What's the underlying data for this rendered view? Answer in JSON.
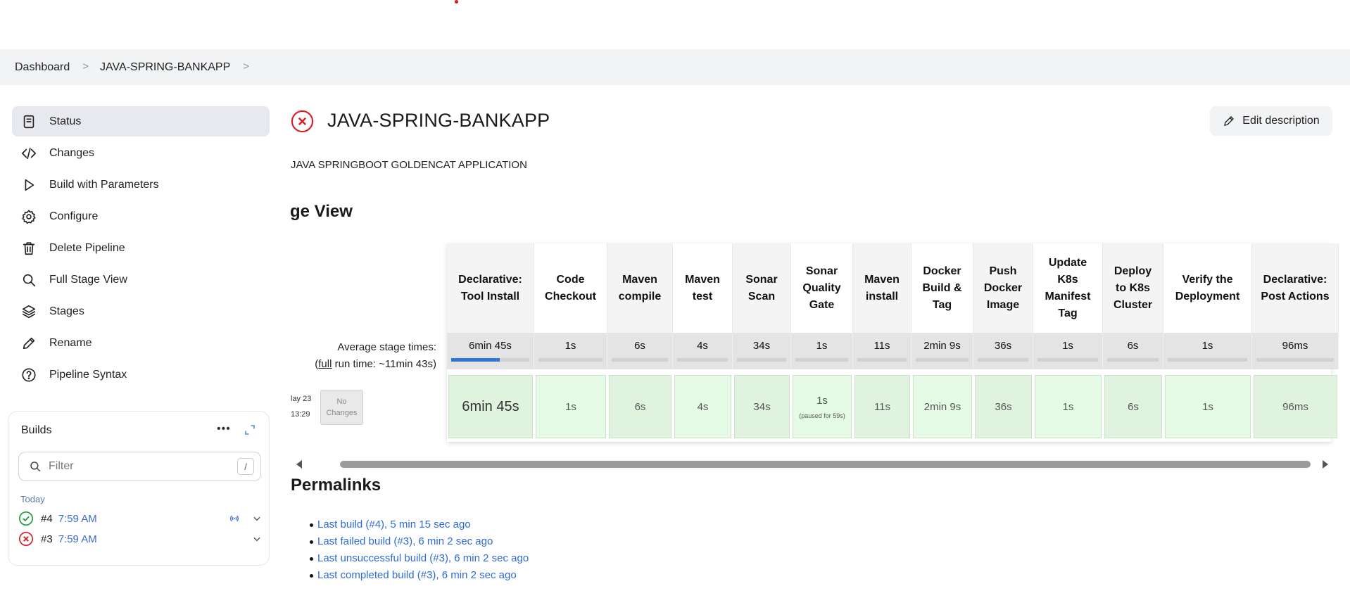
{
  "breadcrumb": {
    "items": [
      "Dashboard",
      "JAVA-SPRING-BANKAPP"
    ]
  },
  "sidebar": {
    "items": [
      {
        "label": "Status",
        "icon": "document-icon",
        "active": true
      },
      {
        "label": "Changes",
        "icon": "code-icon"
      },
      {
        "label": "Build with Parameters",
        "icon": "play-icon"
      },
      {
        "label": "Configure",
        "icon": "gear-icon"
      },
      {
        "label": "Delete Pipeline",
        "icon": "trash-icon"
      },
      {
        "label": "Full Stage View",
        "icon": "search-icon"
      },
      {
        "label": "Stages",
        "icon": "layers-icon"
      },
      {
        "label": "Rename",
        "icon": "pencil-icon"
      },
      {
        "label": "Pipeline Syntax",
        "icon": "help-icon"
      }
    ]
  },
  "builds": {
    "title": "Builds",
    "more": "•••",
    "filter_placeholder": "Filter",
    "filter_shortcut": "/",
    "group": "Today",
    "rows": [
      {
        "number": "#4",
        "time": "7:59 AM",
        "status": "success"
      },
      {
        "number": "#3",
        "time": "7:59 AM",
        "status": "failed"
      }
    ]
  },
  "job": {
    "title": "JAVA-SPRING-BANKAPP",
    "description": "JAVA SPRINGBOOT GOLDENCAT APPLICATION",
    "edit_label": "Edit description",
    "status_color": "#d81f26"
  },
  "stage_view": {
    "title": "ge View",
    "avg_label_line1": "Average stage times:",
    "avg_label_full": "full",
    "avg_label_rest": " run time: ~11min 43s)",
    "avg_label_open": "(",
    "run_date_line1": "lay 23",
    "run_date_line2": "13:29",
    "no_changes": "No Changes",
    "stages": [
      {
        "name": "Declarative: Tool Install",
        "avg": "6min 45s",
        "run": "6min 45s",
        "fill": 0.62
      },
      {
        "name": "Code Checkout",
        "avg": "1s",
        "run": "1s",
        "fill": 0.0
      },
      {
        "name": "Maven compile",
        "avg": "6s",
        "run": "6s",
        "fill": 0.0
      },
      {
        "name": "Maven test",
        "avg": "4s",
        "run": "4s",
        "fill": 0.0
      },
      {
        "name": "Sonar Scan",
        "avg": "34s",
        "run": "34s",
        "fill": 0.0
      },
      {
        "name": "Sonar Quality Gate",
        "avg": "1s",
        "run": "1s",
        "note": "(paused for 59s)",
        "fill": 0.0
      },
      {
        "name": "Maven install",
        "avg": "11s",
        "run": "11s",
        "fill": 0.0
      },
      {
        "name": "Docker Build & Tag",
        "avg": "2min 9s",
        "run": "2min 9s",
        "fill": 0.0
      },
      {
        "name": "Push Docker Image",
        "avg": "36s",
        "run": "36s",
        "fill": 0.0
      },
      {
        "name": "Update K8s Manifest Tag",
        "avg": "1s",
        "run": "1s",
        "fill": 0.0
      },
      {
        "name": "Deploy to K8s Cluster",
        "avg": "6s",
        "run": "6s",
        "fill": 0.0
      },
      {
        "name": "Verify the Deployment",
        "avg": "1s",
        "run": "1s",
        "fill": 0.0
      },
      {
        "name": "Declarative: Post Actions",
        "avg": "96ms",
        "run": "96ms",
        "fill": 0.0
      }
    ]
  },
  "permalinks": {
    "title": "Permalinks",
    "links": [
      "Last build (#4), 5 min 15 sec ago",
      "Last failed build (#3), 6 min 2 sec ago",
      "Last unsuccessful build (#3), 6 min 2 sec ago",
      "Last completed build (#3), 6 min 2 sec ago"
    ]
  },
  "colors": {
    "accent": "#2f6bd6",
    "success": "#1f9d45",
    "failure": "#d81f26"
  }
}
